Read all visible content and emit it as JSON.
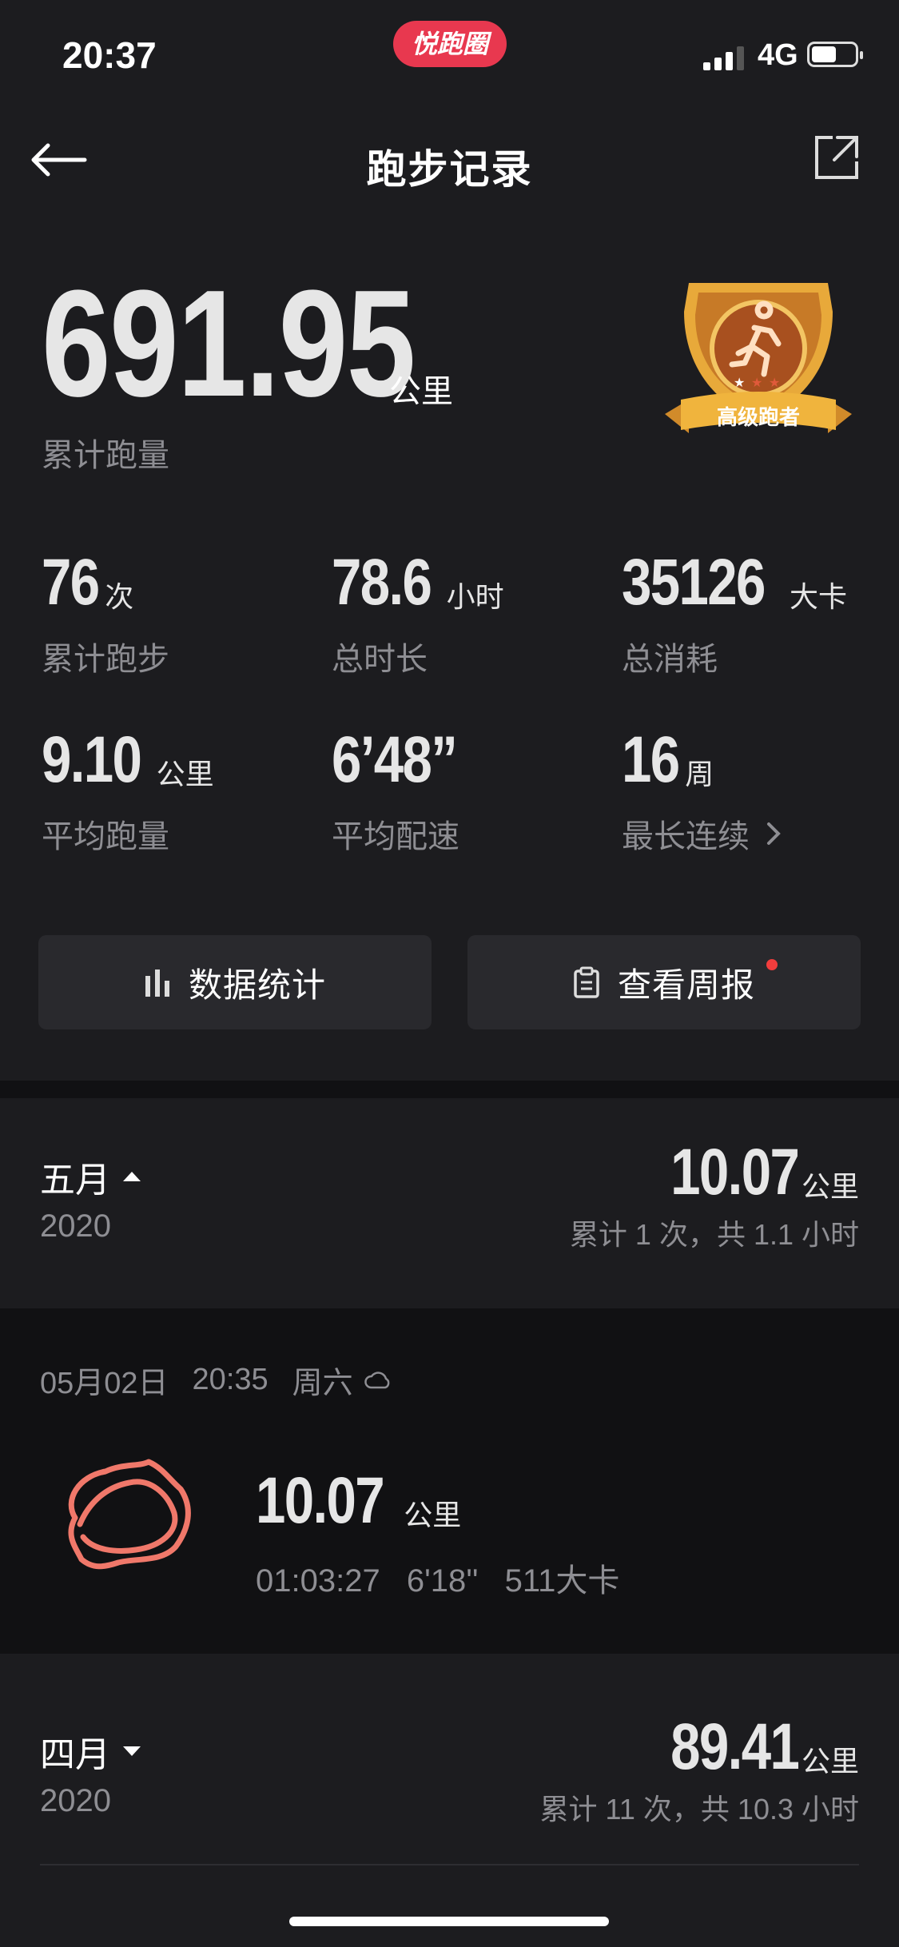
{
  "status_bar": {
    "time": "20:37",
    "app_badge": "悦跑圈",
    "network": "4G"
  },
  "nav": {
    "title": "跑步记录"
  },
  "summary": {
    "total_distance": "691.95",
    "distance_unit": "公里",
    "distance_label": "累计跑量",
    "badge_text": "高级跑者"
  },
  "stats": [
    {
      "value": "76",
      "unit": "次",
      "label": "累计跑步"
    },
    {
      "value": "78.6",
      "unit": "小时",
      "label": "总时长"
    },
    {
      "value": "35126",
      "unit": "大卡",
      "label": "总消耗"
    },
    {
      "value": "9.10",
      "unit": "公里",
      "label": "平均跑量"
    },
    {
      "value": "6’48”",
      "unit": "",
      "label": "平均配速"
    },
    {
      "value": "16",
      "unit": "周",
      "label": "最长连续"
    }
  ],
  "buttons": {
    "stats": "数据统计",
    "weekly": "查看周报"
  },
  "months": [
    {
      "name": "五月",
      "year": "2020",
      "distance": "10.07",
      "unit": "公里",
      "summary": "累计 1 次，共 1.1 小时",
      "expanded": true
    },
    {
      "name": "四月",
      "year": "2020",
      "distance": "89.41",
      "unit": "公里",
      "summary": "累计 11 次，共 10.3 小时",
      "expanded": false
    }
  ],
  "record": {
    "date": "05月02日",
    "time": "20:35",
    "weekday": "周六",
    "weather_icon": "cloud-icon",
    "distance": "10.07",
    "unit": "公里",
    "duration": "01:03:27",
    "pace": "6'18''",
    "calories": "511大卡",
    "route_color": "#f0786a"
  },
  "colors": {
    "accent_red": "#e8384f",
    "notify_dot": "#f23d3d",
    "badge_gold": "#e8a93a"
  }
}
